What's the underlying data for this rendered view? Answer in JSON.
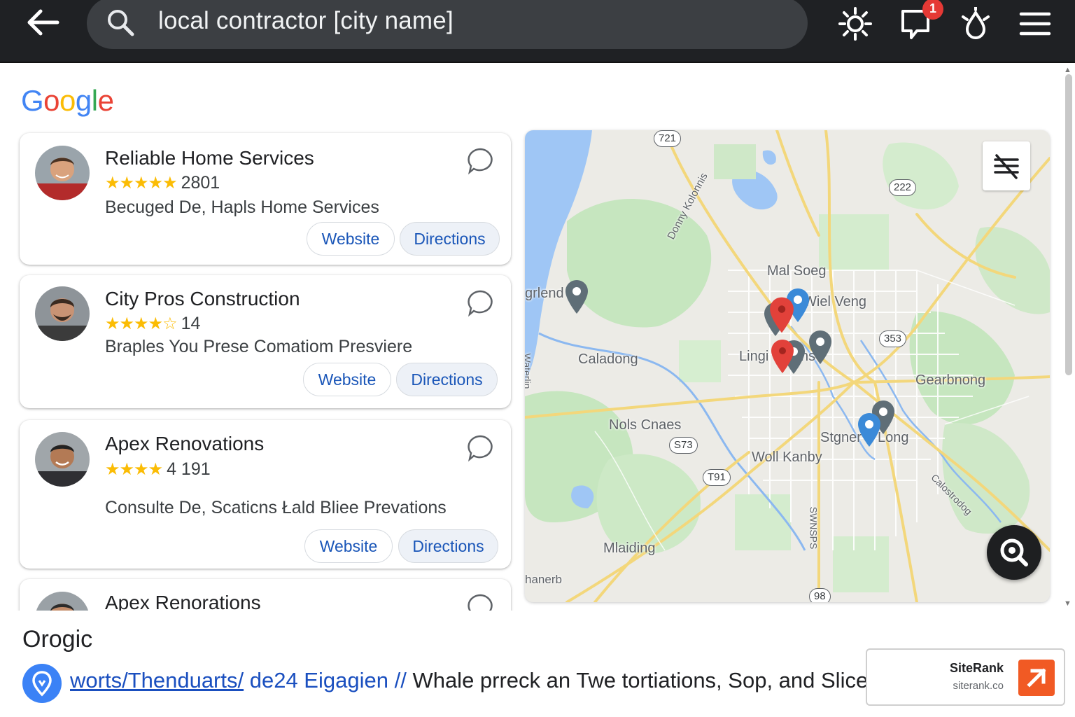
{
  "search": {
    "query": "local contractor [city name]"
  },
  "toolbar": {
    "notification_count": "1"
  },
  "logo": {
    "letters": [
      "G",
      "o",
      "o",
      "g",
      "l",
      "e"
    ],
    "colors": [
      "#4285F4",
      "#EA4335",
      "#FBBC05",
      "#4285F4",
      "#34A853",
      "#EA4335"
    ]
  },
  "listings": [
    {
      "name": "Reliable Home Services",
      "stars": "★★★★★",
      "rating": "2801",
      "description": "Becuged De, Hapls Home Services",
      "website_label": "Website",
      "directions_label": "Directions"
    },
    {
      "name": "City Pros Construction",
      "stars": "★★★★☆",
      "rating": "14",
      "description": "Braples You Prese Comatiom Presviere",
      "website_label": "Website",
      "directions_label": "Directions"
    },
    {
      "name": "Apex Renovations",
      "stars": "★★★★",
      "rating": "4 191",
      "description": "Consulte De, Scaticns Łald Bliee Prevations",
      "website_label": "Website",
      "directions_label": "Directions"
    },
    {
      "name": "Apex Renorations"
    }
  ],
  "map": {
    "labels": [
      "Mal Soeg",
      "Wiel Veng",
      "grlend",
      "Caladong",
      "Lingi",
      "ns",
      "Gearbnong",
      "Nols Cnaes",
      "Stgner",
      "Long",
      "Woll Kanby",
      "Mlaiding",
      "hanerb",
      "Donny Kolonnis",
      "Waterlin",
      "Calostrodog",
      "SWNSPS"
    ],
    "shields": [
      "721",
      "222",
      "353",
      "S73",
      "T91",
      "98"
    ]
  },
  "organic": {
    "title": "Orogic",
    "link": "worts/Thenduarts/",
    "link_tail": "de24 Eigagien //",
    "snippet": "Whale prreck an Twe tortiations, Sop, and Slices Gr"
  },
  "siterank": {
    "name": "SiteRank",
    "url": "siterank.co"
  }
}
